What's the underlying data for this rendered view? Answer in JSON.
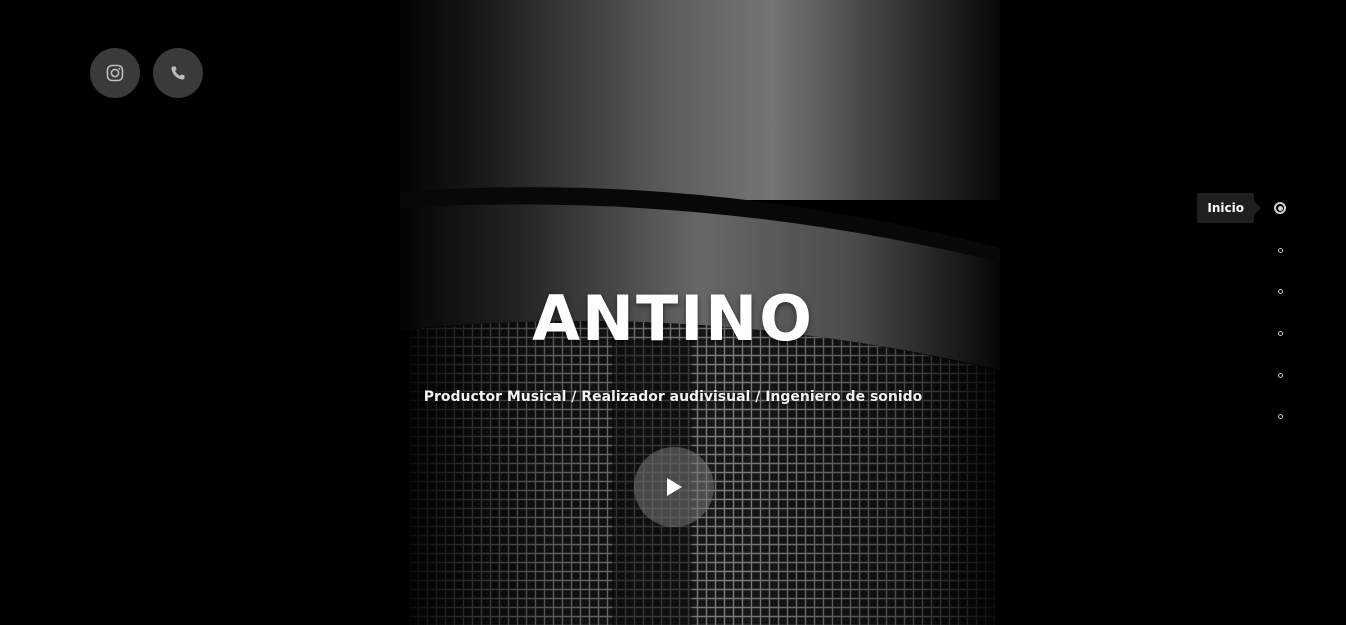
{
  "site": {
    "title": "ANTINO",
    "subtitle": "Productor Musical / Realizador audivisual / Ingeniero de sonido"
  },
  "social": [
    {
      "icon": "instagram-icon"
    },
    {
      "icon": "phone-icon"
    }
  ],
  "play": {
    "icon": "play-icon"
  },
  "side_nav": {
    "active_label": "Inicio",
    "active_index": 0,
    "count": 6
  },
  "colors": {
    "background": "#000000",
    "button_bg": "#3a3a3a",
    "text": "#ffffff"
  }
}
